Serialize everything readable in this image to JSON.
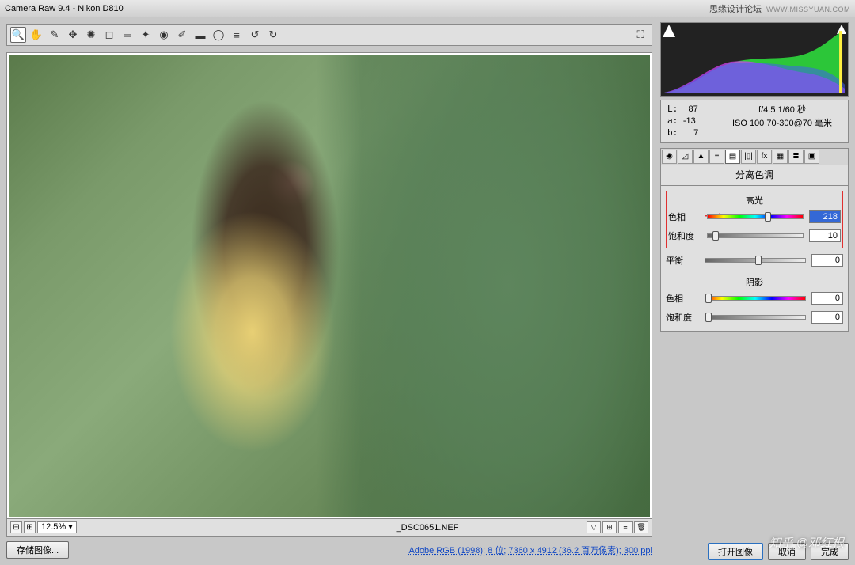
{
  "title": "Camera Raw 9.4  -  Nikon D810",
  "branding": {
    "text": "思缘设计论坛",
    "url": "WWW.MISSYUAN.COM"
  },
  "toolbar_icons": [
    "zoom",
    "hand",
    "eyedrop",
    "sampler",
    "target",
    "crop",
    "straighten",
    "spot",
    "redeye",
    "brush",
    "grad",
    "radial",
    "prefs",
    "rotate-ccw",
    "rotate-cw"
  ],
  "zoom": {
    "value": "12.5%"
  },
  "filename": "_DSC0651.NEF",
  "save_button": "存储图像...",
  "metadata_link": "Adobe RGB (1998); 8 位; 7360 x 4912 (36.2 百万像素); 300 ppi",
  "histogram": {
    "lab": {
      "L": "87",
      "a": "-13",
      "b": "7"
    },
    "exif": {
      "aperture_shutter": "f/4.5  1/60 秒",
      "iso_lens": "ISO 100  70-300@70 毫米"
    }
  },
  "panel": {
    "title": "分离色调",
    "tabs": [
      "◉",
      "◿",
      "▲",
      "≡",
      "▤",
      "|▯|",
      "fx",
      "▦",
      "≣",
      "▣",
      "▭"
    ],
    "highlights_label": "高光",
    "shadows_label": "阴影",
    "rows": {
      "h_hue": {
        "label": "色相",
        "value": "218",
        "pos": 60,
        "hue": true,
        "selected": true
      },
      "h_sat": {
        "label": "饱和度",
        "value": "10",
        "pos": 5,
        "hue": false
      },
      "balance": {
        "label": "平衡",
        "value": "0",
        "pos": 50,
        "hue": false
      },
      "s_hue": {
        "label": "色相",
        "value": "0",
        "pos": 0,
        "hue": true
      },
      "s_sat": {
        "label": "饱和度",
        "value": "0",
        "pos": 0,
        "hue": false
      }
    }
  },
  "buttons": {
    "open": "打开图像",
    "cancel": "取消",
    "done": "完成"
  },
  "watermark": "知乎 @邓红根"
}
